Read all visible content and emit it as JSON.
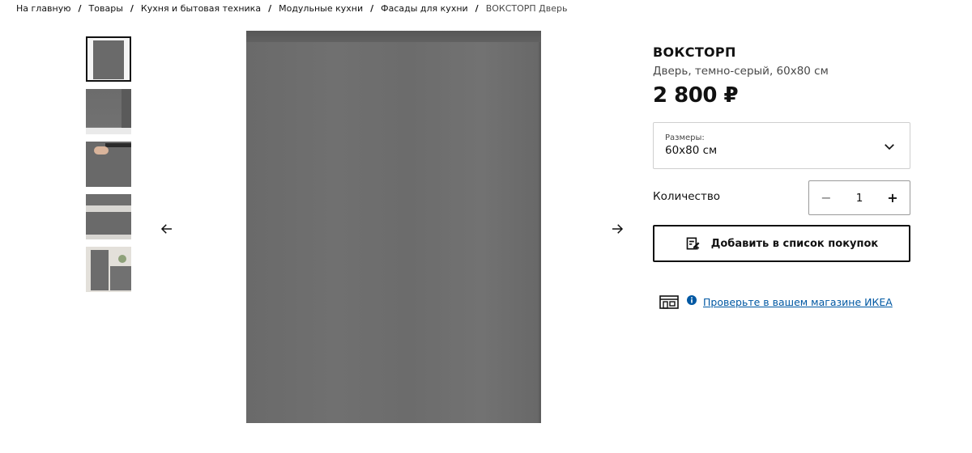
{
  "breadcrumb": {
    "items": [
      {
        "label": "На главную"
      },
      {
        "label": "Товары"
      },
      {
        "label": "Кухня и бытовая техника"
      },
      {
        "label": "Модульные кухни"
      },
      {
        "label": "Фасады для кухни"
      }
    ],
    "current": "ВОКСТОРП Дверь",
    "separator": "/"
  },
  "gallery": {
    "thumbnails": [
      {
        "icon": "door-front-thumbnail"
      },
      {
        "icon": "door-edge-thumbnail"
      },
      {
        "icon": "door-hand-thumbnail"
      },
      {
        "icon": "kitchen-thumbnail"
      },
      {
        "icon": "kitchen-tall-thumbnail"
      }
    ],
    "prev_icon": "arrow-left-icon",
    "next_icon": "arrow-right-icon",
    "main_image_color": "#6b6b6b"
  },
  "product": {
    "name": "ВОКСТОРП",
    "description": "Дверь, темно-серый, 60x80 см",
    "price": "2 800 ₽"
  },
  "size_selector": {
    "label": "Размеры:",
    "value": "60x80 см",
    "icon": "chevron-down-icon"
  },
  "quantity": {
    "label": "Количество",
    "value": "1",
    "minus": "−",
    "plus": "+"
  },
  "add_to_list": {
    "label": "Добавить в список покупок",
    "icon": "shopping-list-icon"
  },
  "store_check": {
    "link": "Проверьте в вашем магазине ИКЕА",
    "store_icon": "store-icon",
    "info_icon": "info-icon",
    "link_color": "#0058a3"
  }
}
